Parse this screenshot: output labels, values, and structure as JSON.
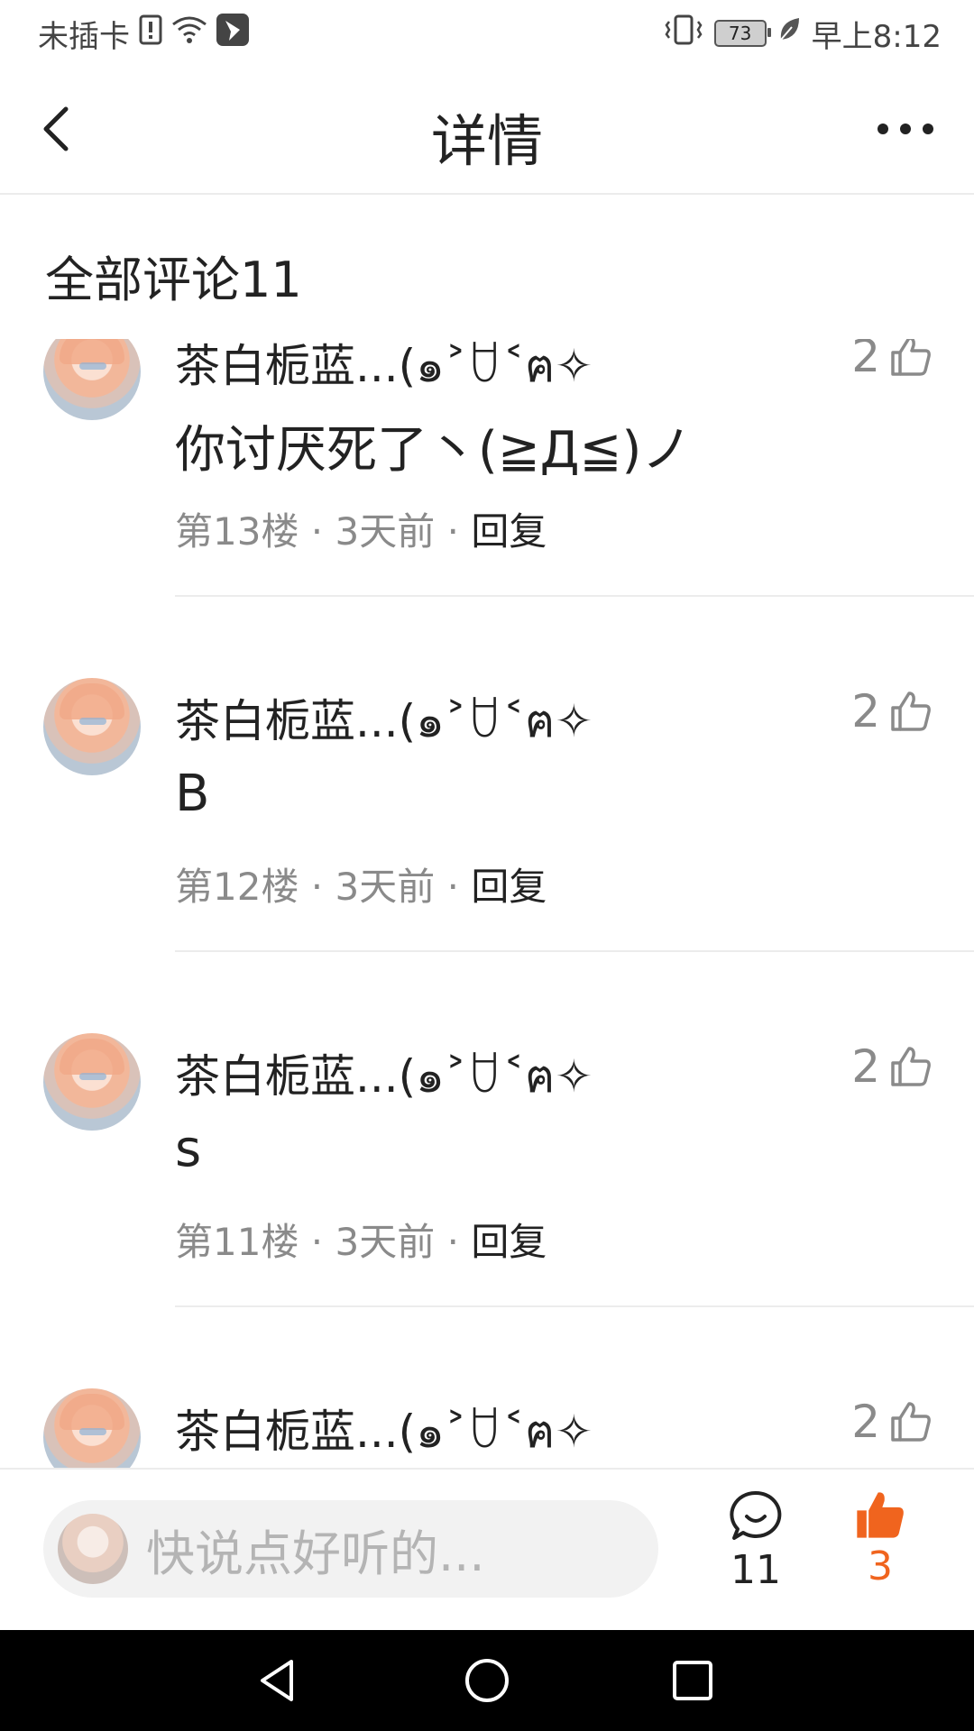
{
  "status_bar": {
    "carrier": "未插卡",
    "battery": "73",
    "time": "早上8:12",
    "icons": [
      "sim-alert-icon",
      "wifi-icon",
      "app-notification-icon",
      "vibrate-icon",
      "battery-icon",
      "leaf-icon"
    ]
  },
  "header": {
    "title": "详情",
    "back_icon": "back-arrow-icon",
    "more_icon": "more-dots-icon"
  },
  "comments_section": {
    "heading": "全部评论11"
  },
  "comments": [
    {
      "username": "茶白栀蓝...(๑˃ꇴ˂ฅ✧",
      "likes": "2",
      "text": "你讨厌死了丶(≧Д≦)ノ",
      "floor": "第13楼",
      "time": "3天前",
      "reply": "回复"
    },
    {
      "username": "茶白栀蓝...(๑˃ꇴ˂ฅ✧",
      "likes": "2",
      "text": "B",
      "floor": "第12楼",
      "time": "3天前",
      "reply": "回复"
    },
    {
      "username": "茶白栀蓝...(๑˃ꇴ˂ฅ✧",
      "likes": "2",
      "text": "s",
      "floor": "第11楼",
      "time": "3天前",
      "reply": "回复"
    },
    {
      "username": "茶白栀蓝...(๑˃ꇴ˂ฅ✧",
      "likes": "2",
      "text": "",
      "floor": "",
      "time": "",
      "reply": ""
    }
  ],
  "bottom_bar": {
    "placeholder": "快说点好听的...",
    "comment_count": "11",
    "like_count": "3",
    "like_color": "#f0641e"
  },
  "nav_bar": {
    "icons": [
      "back-triangle-icon",
      "home-circle-icon",
      "recent-square-icon"
    ]
  }
}
